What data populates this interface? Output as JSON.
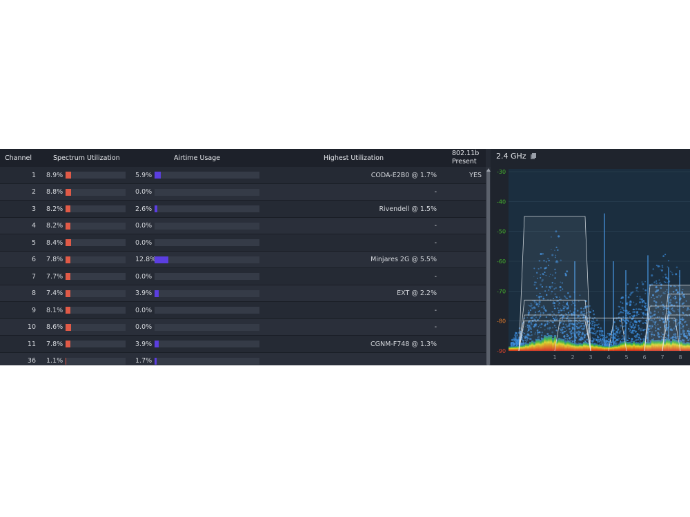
{
  "table": {
    "headers": {
      "channel": "Channel",
      "spectrum": "Spectrum Utilization",
      "airtime": "Airtime Usage",
      "highest": "Highest Utilization",
      "b_line1": "802.11b",
      "b_line2": "Present"
    },
    "rows": [
      {
        "channel": "1",
        "spectrum": "8.9%",
        "spectrum_value": 8.9,
        "airtime": "5.9%",
        "airtime_value": 5.9,
        "highest": "CODA-E2B0 @ 1.7%",
        "b": "YES"
      },
      {
        "channel": "2",
        "spectrum": "8.8%",
        "spectrum_value": 8.8,
        "airtime": "0.0%",
        "airtime_value": 0.0,
        "highest": "-",
        "b": ""
      },
      {
        "channel": "3",
        "spectrum": "8.2%",
        "spectrum_value": 8.2,
        "airtime": "2.6%",
        "airtime_value": 2.6,
        "highest": "Rivendell @ 1.5%",
        "b": ""
      },
      {
        "channel": "4",
        "spectrum": "8.2%",
        "spectrum_value": 8.2,
        "airtime": "0.0%",
        "airtime_value": 0.0,
        "highest": "-",
        "b": ""
      },
      {
        "channel": "5",
        "spectrum": "8.4%",
        "spectrum_value": 8.4,
        "airtime": "0.0%",
        "airtime_value": 0.0,
        "highest": "-",
        "b": ""
      },
      {
        "channel": "6",
        "spectrum": "7.8%",
        "spectrum_value": 7.8,
        "airtime": "12.8%",
        "airtime_value": 12.8,
        "highest": "Minjares 2G @ 5.5%",
        "b": ""
      },
      {
        "channel": "7",
        "spectrum": "7.7%",
        "spectrum_value": 7.7,
        "airtime": "0.0%",
        "airtime_value": 0.0,
        "highest": "-",
        "b": ""
      },
      {
        "channel": "8",
        "spectrum": "7.4%",
        "spectrum_value": 7.4,
        "airtime": "3.9%",
        "airtime_value": 3.9,
        "highest": "EXT @ 2.2%",
        "b": ""
      },
      {
        "channel": "9",
        "spectrum": "8.1%",
        "spectrum_value": 8.1,
        "airtime": "0.0%",
        "airtime_value": 0.0,
        "highest": "-",
        "b": ""
      },
      {
        "channel": "10",
        "spectrum": "8.6%",
        "spectrum_value": 8.6,
        "airtime": "0.0%",
        "airtime_value": 0.0,
        "highest": "-",
        "b": ""
      },
      {
        "channel": "11",
        "spectrum": "7.8%",
        "spectrum_value": 7.8,
        "airtime": "3.9%",
        "airtime_value": 3.9,
        "highest": "CGNM-F748 @ 1.3%",
        "b": ""
      },
      {
        "channel": "36",
        "spectrum": "1.1%",
        "spectrum_value": 1.1,
        "airtime": "1.7%",
        "airtime_value": 1.7,
        "highest": "",
        "b": ""
      }
    ]
  },
  "spectrum": {
    "title": "2.4 GHz",
    "y_ticks": [
      {
        "label": "-30",
        "color": "#45b52e"
      },
      {
        "label": "-40",
        "color": "#45b52e"
      },
      {
        "label": "-50",
        "color": "#45b52e"
      },
      {
        "label": "-60",
        "color": "#45b52e"
      },
      {
        "label": "-70",
        "color": "#45b52e"
      },
      {
        "label": "-80",
        "color": "#e07a2a"
      },
      {
        "label": "-90",
        "color": "#d9432c"
      }
    ],
    "x_ticks": [
      "1",
      "2",
      "3",
      "4",
      "5",
      "6",
      "7",
      "8"
    ]
  },
  "colors": {
    "spectrum_bar": "#e05a47",
    "airtime_bar": "#5b3ee0",
    "background": "#252a34"
  }
}
